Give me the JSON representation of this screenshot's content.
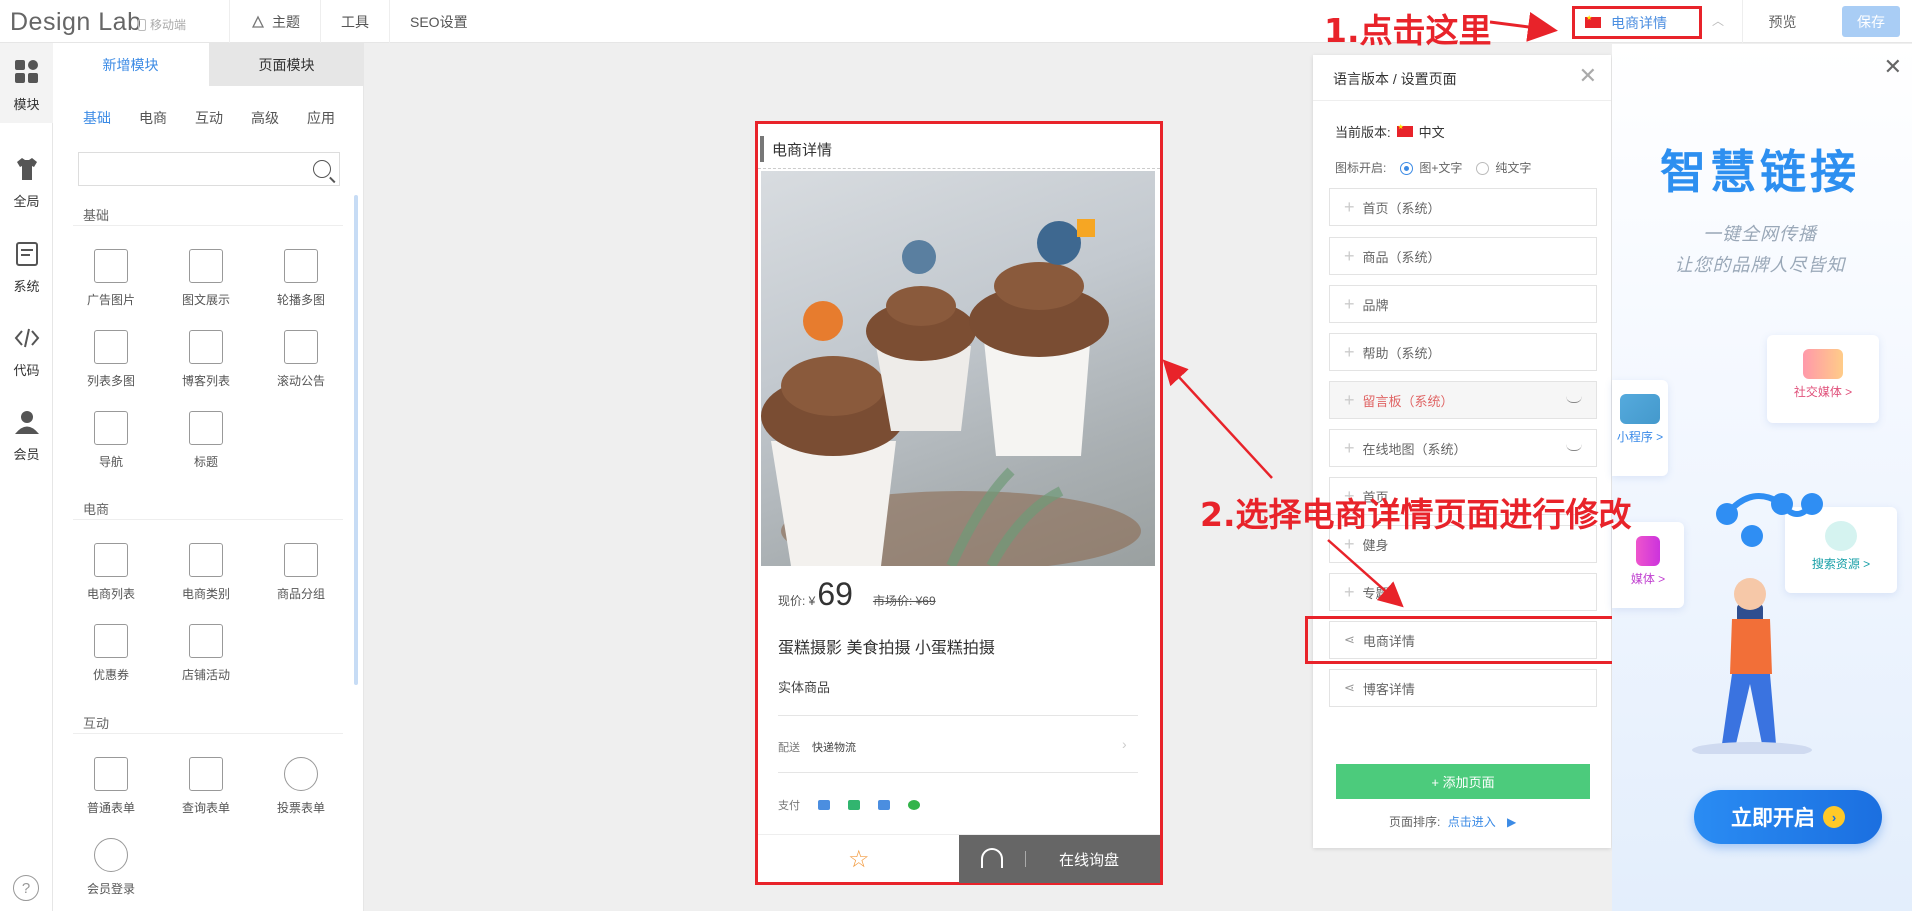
{
  "topbar": {
    "logo": "Design Lab",
    "mobile_tag": "移动端",
    "nav": [
      "主题",
      "工具",
      "SEO设置"
    ],
    "page_select": "电商详情",
    "preview": "预览",
    "save": "保存"
  },
  "rail": [
    "模块",
    "全局",
    "系统",
    "代码",
    "会员"
  ],
  "panel": {
    "tabs": [
      "新增模块",
      "页面模块"
    ],
    "subtabs": [
      "基础",
      "电商",
      "互动",
      "高级",
      "应用"
    ],
    "search_placeholder": "",
    "sections": {
      "basic": "基础",
      "ecom": "电商",
      "interact": "互动"
    },
    "basic_modules": [
      "广告图片",
      "图文展示",
      "轮播多图",
      "列表多图",
      "博客列表",
      "滚动公告",
      "导航",
      "标题"
    ],
    "ecom_modules": [
      "电商列表",
      "电商类别",
      "商品分组",
      "优惠券",
      "店铺活动"
    ],
    "interact_modules": [
      "普通表单",
      "查询表单",
      "投票表单",
      "会员登录"
    ]
  },
  "phone": {
    "title": "电商详情",
    "price_label": "现价: ¥",
    "price": "69",
    "market_label": "市场价: ¥69",
    "name": "蛋糕摄影 美食拍摄 小蛋糕拍摄",
    "type": "实体商品",
    "ship_label": "配送",
    "ship_value": "快递物流",
    "pay_label": "支付",
    "inquire": "在线询盘"
  },
  "settings": {
    "title": "语言版本 / 设置页面",
    "current_version_label": "当前版本:",
    "current_version": "中文",
    "icon_mode_label": "图标开启:",
    "icon_mode_options": [
      "图+文字",
      "纯文字"
    ],
    "pages": [
      "首页（系统）",
      "商品（系统）",
      "品牌",
      "帮助（系统）",
      "留言板（系统）",
      "在线地图（系统）",
      "首页",
      "健身",
      "专题",
      "电商详情",
      "博客详情"
    ],
    "add_page": "+ 添加页面",
    "sort_label": "页面排序:",
    "sort_link": "点击进入"
  },
  "ad": {
    "title": "智慧链接",
    "sub1": "一键全网传播",
    "sub2": "让您的品牌人尽皆知",
    "cards": [
      "社交媒体 >",
      "小程序 >",
      "媒体 >",
      "搜索资源 >"
    ],
    "cta": "立即开启"
  },
  "annotations": {
    "step1": "1.点击这里",
    "step2": "2.选择电商详情页面进行修改"
  }
}
